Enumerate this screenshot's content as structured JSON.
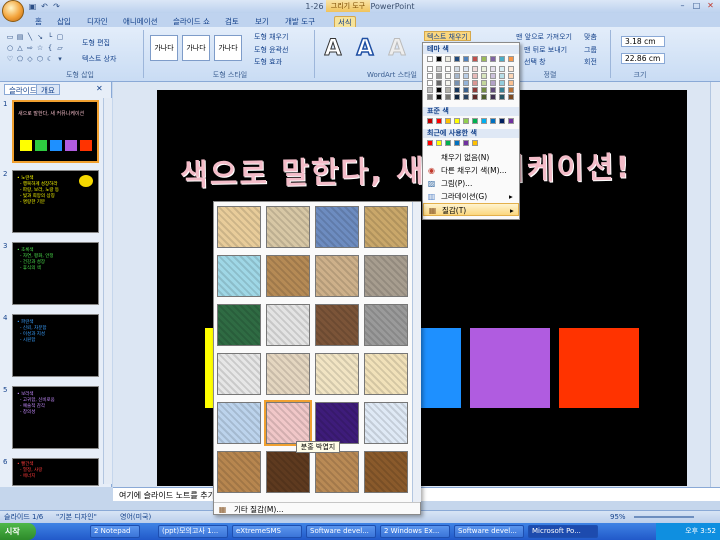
{
  "window": {
    "title": "1-26 - Microsoft PowerPoint",
    "context_tab": "그리기 도구"
  },
  "tabs": [
    "홈",
    "삽입",
    "디자인",
    "애니메이션",
    "슬라이드 쇼",
    "검토",
    "보기",
    "개발 도구",
    "서식"
  ],
  "ribbon": {
    "group_insert_shapes": "도형 삽입",
    "edit_shape": "도형 편집",
    "text_box": "텍스트 상자",
    "style_sample": "가나다",
    "shape_fill": "도형 채우기",
    "shape_outline": "도형 윤곽선",
    "shape_effects": "도형 효과",
    "group_shape_styles": "도형 스타일",
    "wordart_letter": "A",
    "group_wordart": "WordArt 스타일",
    "text_fill": "텍스트 채우기",
    "bring_front": "맨 앞으로 가져오기",
    "send_back": "맨 뒤로 보내기",
    "selection_pane": "선택 창",
    "align": "맞춤",
    "group": "그룹",
    "rotate": "회전",
    "group_arrange": "정렬",
    "height": "3.18 cm",
    "width": "22.86 cm",
    "group_size": "크기"
  },
  "pane_tabs": [
    "슬라이드",
    "개요"
  ],
  "slides": [
    {
      "num": "1",
      "title": "새으로 말한다, 새 커뮤니케이션"
    },
    {
      "num": "2",
      "lines": [
        "• 노란색",
        "  - 행복하게 성장하라",
        "  - 파랑, 보라, 노랑 등",
        "  - 빛과 희망의 상징",
        "  - 명랑한 기분"
      ]
    },
    {
      "num": "3",
      "lines": [
        "• 초록색",
        "  - 자연, 평화, 안정",
        "  - 건강과 성장",
        "  - 휴식의 색"
      ]
    },
    {
      "num": "4",
      "lines": [
        "• 파란색",
        "  - 신뢰, 차분함",
        "  - 이성과 지성",
        "  - 시원함"
      ]
    },
    {
      "num": "5",
      "lines": [
        "• 보라색",
        "  - 고귀함, 신비로움",
        "  - 예술적 감각",
        "  - 창의성"
      ]
    },
    {
      "num": "6",
      "lines": [
        "• 빨간색",
        "  - 열정, 사랑",
        "  - 에너지",
        "  - 위험"
      ]
    }
  ],
  "slide": {
    "headline": "색으로 말한다, 새 커뮤니케이션!",
    "squares": [
      "#ffff00",
      "#2ecc40",
      "#1e90ff",
      "#b05ce0",
      "#ff3300"
    ]
  },
  "notes_placeholder": "여기에 슬라이드 노트를 추가하십시오.",
  "fill_menu": {
    "theme_colors": "테마 색",
    "standard_colors": "표준 색",
    "recent_colors": "최근에 사용한 색",
    "items": [
      "채우기 없음(N)",
      "다른 채우기 색(M)...",
      "그림(P)...",
      "그라데이션(G)",
      "질감(T)"
    ],
    "theme_row": [
      "#ffffff",
      "#000000",
      "#eeece1",
      "#1f497d",
      "#4f81bd",
      "#c0504d",
      "#9bbb59",
      "#8064a2",
      "#4bacc6",
      "#f79646"
    ],
    "standard_row": [
      "#c00000",
      "#ff0000",
      "#ffc000",
      "#ffff00",
      "#92d050",
      "#00b050",
      "#00b0f0",
      "#0070c0",
      "#002060",
      "#7030a0"
    ],
    "recent_row": [
      "#ff0000",
      "#ffff00",
      "#00b050",
      "#0070c0",
      "#7030a0",
      "#ffc000"
    ]
  },
  "texture_menu": {
    "more_textures": "기타 질감(M)...",
    "tooltip": "분홍 박엽지",
    "textures": [
      "papyrus",
      "canvas",
      "denim",
      "woven-mat",
      "water-droplets",
      "paper-bag",
      "fish-fossil",
      "sand",
      "green-marble",
      "white-marble",
      "brown-marble",
      "granite",
      "newsprint",
      "recycled-paper",
      "parchment",
      "stationery",
      "blue-tissue",
      "pink-tissue",
      "purple-mesh",
      "bouquet",
      "cork",
      "walnut",
      "oak",
      "medium-wood"
    ],
    "colors": [
      "#e8cc9a",
      "#d7c7a5",
      "#6d8cc0",
      "#c9a76a",
      "#9fd7e6",
      "#b58a55",
      "#cdb08a",
      "#a79d8f",
      "#2f6b43",
      "#e3e3e3",
      "#7b5438",
      "#9a9a9a",
      "#e6e6e6",
      "#e4d6c0",
      "#f1e4c3",
      "#f1e1b9",
      "#bcd3ec",
      "#f0c7c8",
      "#3e1c7a",
      "#dfe9f5",
      "#b7864f",
      "#5e3a1f",
      "#b98a55",
      "#8a5a2b"
    ]
  },
  "status": {
    "slide_info": "슬라이드 1/6",
    "theme": "\"기본 디자인\"",
    "lang": "영어(미국)",
    "zoom": "95%"
  },
  "taskbar": {
    "start": "시작",
    "items": [
      "2 Notepad",
      "(ppt)모의고사 1...",
      "eXtremeSMS",
      "Software devel...",
      "2 Windows Ex...",
      "Software devel...",
      "Microsoft Po..."
    ],
    "clock": "오후 3:52"
  }
}
